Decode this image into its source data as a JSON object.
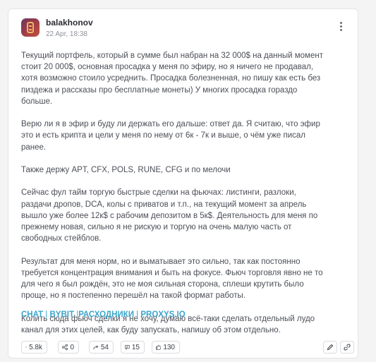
{
  "post": {
    "author": "balakhonov",
    "date": "22 Apr, 18:38",
    "paragraphs": [
      "Текущий портфель, который в сумме был набран на 32 000$ на данный момент стоит 20 000$, основная просадка у меня по эфиру, но я ничего не продавал, хотя возможно стоило усреднить. Просадка болезненная, но пишу как есть без пиздежа и рассказы про бесплатные монеты) У многих просадка гораздо больше.",
      "Верю ли я в эфир и буду ли держать его дальше: ответ да. Я считаю, что эфир это и есть крипта и цели у меня по нему от 6к - 7к и выше, о чём уже писал ранее.",
      "Также держу APT, CFX, POLS, RUNE, CFG и по мелочи",
      "Сейчас фул тайм торгую быстрые сделки на фьючах: листинги, разлоки, раздачи дропов, DCA, колы с приватов и т.п., на текущий момент за апрель вышло уже более 12к$ с рабочим депозитом в 5к$. Деятельность для меня по прежнему новая, сильно я не рискую и торгую на очень малую часть от свободных стейблов.",
      "Результат для меня норм, но и выматывает это сильно, так как постоянно требуется концентрация внимания и быть на фокусе. Фьюч торговля явно не то для чего я был рождён, это не моя сильная сторона, сплеши крутить было проще, но я постепенно перешёл на такой формат работы.",
      "Колить сюда фьюч сделки я не хочу, думаю всё-таки сделать отдельный лудо канал для этих целей, как буду запускать, напишу об этом отдельно."
    ],
    "links": {
      "chat": "CHAT",
      "bybit": "BYBIT",
      "supplies": "РАСХОДНИКИ",
      "proxys": "PROXYS.IO",
      "separator": "|"
    }
  },
  "stats": {
    "views": "5.8k",
    "reactions": "0",
    "shares": "54",
    "comments": "15",
    "likes": "130"
  },
  "colors": {
    "link": "#3aa5c9",
    "text": "#4b4f57",
    "border": "#d9dbe0"
  },
  "icons": [
    "avatar",
    "more-vertical-icon",
    "eye-icon",
    "share-nodes-icon",
    "forward-arrow-icon",
    "comment-icon",
    "thumbs-up-icon",
    "pencil-icon",
    "link-icon"
  ]
}
